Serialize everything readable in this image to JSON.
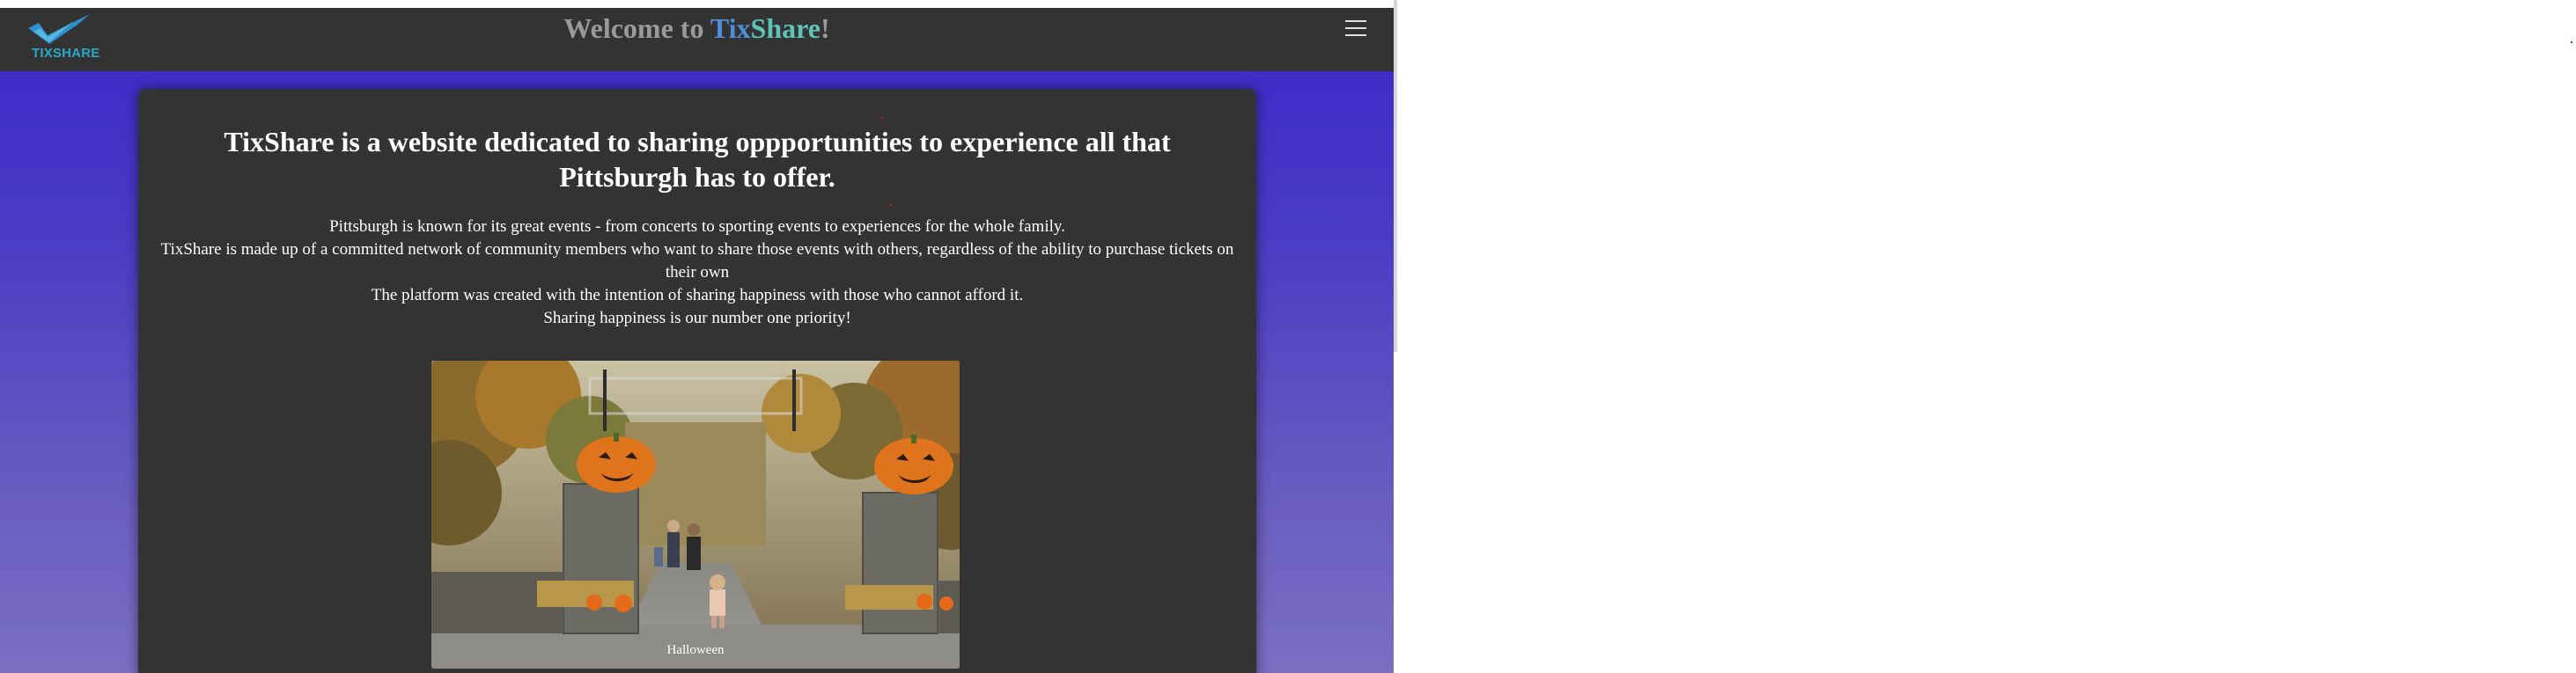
{
  "navbar": {
    "logo_text": "TIXSHARE",
    "welcome_prefix": "Welcome to ",
    "brand_first": "Tix",
    "brand_second": "Share",
    "welcome_suffix": "!",
    "menu_icon": "hamburger-menu-icon"
  },
  "main": {
    "headline": "TixShare is a website dedicated to sharing oppportunities to experience all that Pittsburgh has to offer.",
    "paragraph_lines": [
      "Pittsburgh is known for its great events - from concerts to sporting events to experiences for the whole family.",
      "TixShare is made up of a committed network of community members who want to share those events with others, regardless of the ability to purchase tickets on their own",
      "The platform was created with the intention of sharing happiness with those who cannot afford it.",
      "Sharing happiness is our number one priority!"
    ],
    "slideshow": {
      "caption": "Halloween"
    }
  },
  "colors": {
    "navbar_bg": "#333333",
    "card_bg": "#333333",
    "gradient_top": "#3a26c9",
    "gradient_bottom": "#7a6fc3",
    "brand_blue": "#4d8fd6",
    "brand_teal": "#5fc3b8",
    "logo_teal": "#2aa9c9"
  }
}
